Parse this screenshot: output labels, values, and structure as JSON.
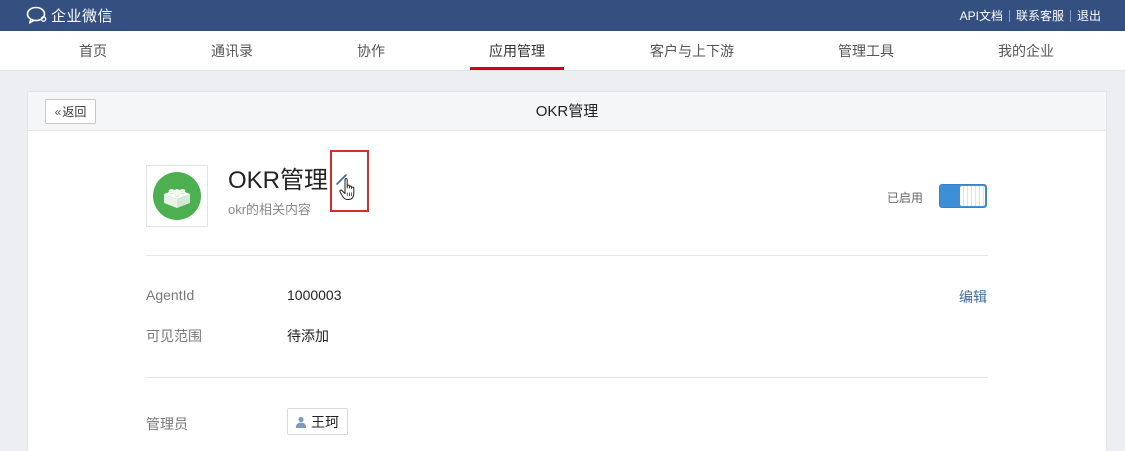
{
  "topbar": {
    "logo_text": "企业微信",
    "links": [
      "API文档",
      "联系客服",
      "退出"
    ]
  },
  "nav": {
    "items": [
      "首页",
      "通讯录",
      "协作",
      "应用管理",
      "客户与上下游",
      "管理工具",
      "我的企业"
    ],
    "active_index": 3
  },
  "header": {
    "back_label": "返回",
    "title": "OKR管理"
  },
  "app": {
    "name": "OKR管理",
    "description": "okr的相关内容",
    "status_label": "已启用",
    "enabled": true,
    "icon": "lego-brick-icon",
    "icon_color": "#4caf50"
  },
  "details": {
    "agentid_label": "AgentId",
    "agentid_value": "1000003",
    "edit_label": "编辑",
    "visible_label": "可见范围",
    "visible_value": "待添加",
    "admin_label": "管理员",
    "admin_name": "王珂"
  },
  "colors": {
    "topbar": "#345081",
    "active_underline": "#d0021b",
    "toggle_on": "#3d8fd7",
    "highlight": "#d32f2f"
  }
}
